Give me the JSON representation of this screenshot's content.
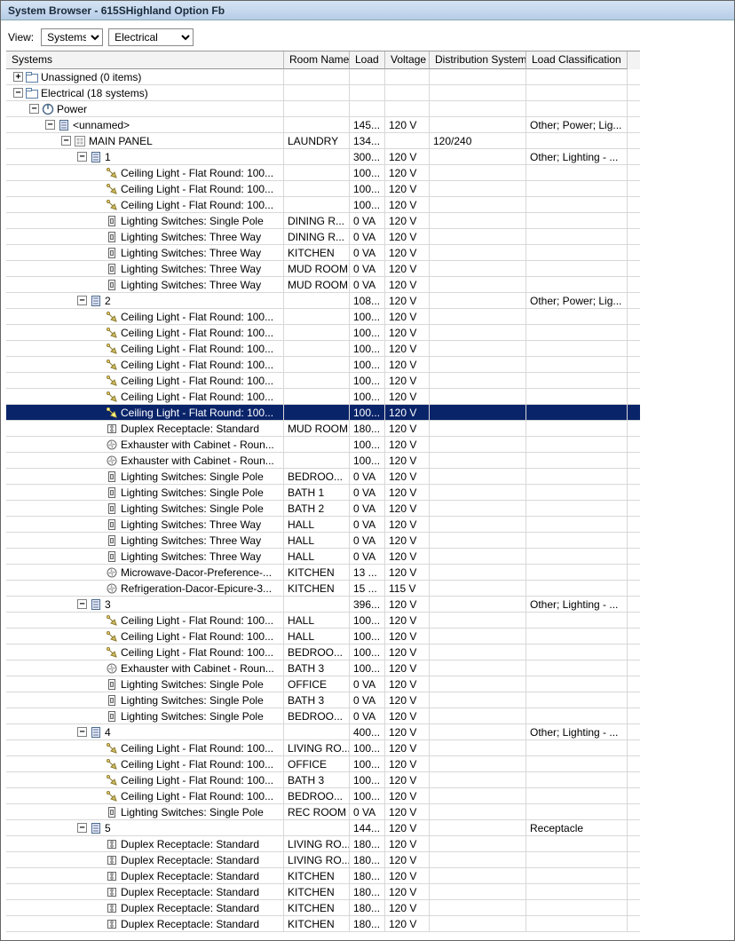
{
  "title": "System Browser - 615SHighland Option Fb",
  "toolbar": {
    "view_label": "View:",
    "view1": "Systems",
    "view2": "Electrical"
  },
  "columns": {
    "systems": "Systems",
    "room": "Room Name",
    "load": "Load",
    "volt": "Voltage",
    "dist": "Distribution System",
    "class": "Load Classification"
  },
  "rows": [
    {
      "indent": 0,
      "tw": "+",
      "icon": "folder",
      "label": "Unassigned (0 items)",
      "room": "",
      "load": "",
      "volt": "",
      "dist": "",
      "class": ""
    },
    {
      "indent": 0,
      "tw": "-",
      "icon": "folder",
      "label": "Electrical (18 systems)",
      "room": "",
      "load": "",
      "volt": "",
      "dist": "",
      "class": ""
    },
    {
      "indent": 1,
      "tw": "-",
      "icon": "power",
      "label": "Power",
      "room": "",
      "load": "",
      "volt": "",
      "dist": "",
      "class": ""
    },
    {
      "indent": 2,
      "tw": "-",
      "icon": "panel",
      "label": "<unnamed>",
      "room": "",
      "load": "145...",
      "volt": "120 V",
      "dist": "",
      "class": "Other; Power; Lig..."
    },
    {
      "indent": 3,
      "tw": "-",
      "icon": "panel2",
      "label": "MAIN PANEL",
      "room": "LAUNDRY",
      "load": "134...",
      "volt": "",
      "dist": "120/240",
      "class": ""
    },
    {
      "indent": 4,
      "tw": "-",
      "icon": "panel",
      "label": "1",
      "room": "",
      "load": "300...",
      "volt": "120 V",
      "dist": "",
      "class": "Other; Lighting - ..."
    },
    {
      "indent": 5,
      "tw": "",
      "icon": "light",
      "label": "Ceiling Light - Flat Round: 100...",
      "room": "",
      "load": "100...",
      "volt": "120 V",
      "dist": "",
      "class": ""
    },
    {
      "indent": 5,
      "tw": "",
      "icon": "light",
      "label": "Ceiling Light - Flat Round: 100...",
      "room": "",
      "load": "100...",
      "volt": "120 V",
      "dist": "",
      "class": ""
    },
    {
      "indent": 5,
      "tw": "",
      "icon": "light",
      "label": "Ceiling Light - Flat Round: 100...",
      "room": "",
      "load": "100...",
      "volt": "120 V",
      "dist": "",
      "class": ""
    },
    {
      "indent": 5,
      "tw": "",
      "icon": "switch",
      "label": "Lighting Switches: Single Pole",
      "room": "DINING R...",
      "load": "0 VA",
      "volt": "120 V",
      "dist": "",
      "class": ""
    },
    {
      "indent": 5,
      "tw": "",
      "icon": "switch",
      "label": "Lighting Switches: Three Way",
      "room": "DINING R...",
      "load": "0 VA",
      "volt": "120 V",
      "dist": "",
      "class": ""
    },
    {
      "indent": 5,
      "tw": "",
      "icon": "switch",
      "label": "Lighting Switches: Three Way",
      "room": "KITCHEN",
      "load": "0 VA",
      "volt": "120 V",
      "dist": "",
      "class": ""
    },
    {
      "indent": 5,
      "tw": "",
      "icon": "switch",
      "label": "Lighting Switches: Three Way",
      "room": "MUD ROOM",
      "load": "0 VA",
      "volt": "120 V",
      "dist": "",
      "class": ""
    },
    {
      "indent": 5,
      "tw": "",
      "icon": "switch",
      "label": "Lighting Switches: Three Way",
      "room": "MUD ROOM",
      "load": "0 VA",
      "volt": "120 V",
      "dist": "",
      "class": ""
    },
    {
      "indent": 4,
      "tw": "-",
      "icon": "panel",
      "label": "2",
      "room": "",
      "load": "108...",
      "volt": "120 V",
      "dist": "",
      "class": "Other; Power; Lig..."
    },
    {
      "indent": 5,
      "tw": "",
      "icon": "light",
      "label": "Ceiling Light - Flat Round: 100...",
      "room": "",
      "load": "100...",
      "volt": "120 V",
      "dist": "",
      "class": ""
    },
    {
      "indent": 5,
      "tw": "",
      "icon": "light",
      "label": "Ceiling Light - Flat Round: 100...",
      "room": "",
      "load": "100...",
      "volt": "120 V",
      "dist": "",
      "class": ""
    },
    {
      "indent": 5,
      "tw": "",
      "icon": "light",
      "label": "Ceiling Light - Flat Round: 100...",
      "room": "",
      "load": "100...",
      "volt": "120 V",
      "dist": "",
      "class": ""
    },
    {
      "indent": 5,
      "tw": "",
      "icon": "light",
      "label": "Ceiling Light - Flat Round: 100...",
      "room": "",
      "load": "100...",
      "volt": "120 V",
      "dist": "",
      "class": ""
    },
    {
      "indent": 5,
      "tw": "",
      "icon": "light",
      "label": "Ceiling Light - Flat Round: 100...",
      "room": "",
      "load": "100...",
      "volt": "120 V",
      "dist": "",
      "class": ""
    },
    {
      "indent": 5,
      "tw": "",
      "icon": "light",
      "label": "Ceiling Light - Flat Round: 100...",
      "room": "",
      "load": "100...",
      "volt": "120 V",
      "dist": "",
      "class": ""
    },
    {
      "indent": 5,
      "tw": "",
      "icon": "light",
      "label": "Ceiling Light - Flat Round: 100...",
      "room": "",
      "load": "100...",
      "volt": "120 V",
      "dist": "",
      "class": "",
      "selected": true
    },
    {
      "indent": 5,
      "tw": "",
      "icon": "outlet",
      "label": "Duplex Receptacle: Standard",
      "room": "MUD ROOM",
      "load": "180...",
      "volt": "120 V",
      "dist": "",
      "class": ""
    },
    {
      "indent": 5,
      "tw": "",
      "icon": "fan",
      "label": "Exhauster with Cabinet - Roun...",
      "room": "",
      "load": "100...",
      "volt": "120 V",
      "dist": "",
      "class": ""
    },
    {
      "indent": 5,
      "tw": "",
      "icon": "fan",
      "label": "Exhauster with Cabinet - Roun...",
      "room": "",
      "load": "100...",
      "volt": "120 V",
      "dist": "",
      "class": ""
    },
    {
      "indent": 5,
      "tw": "",
      "icon": "switch",
      "label": "Lighting Switches: Single Pole",
      "room": "BEDROO...",
      "load": "0 VA",
      "volt": "120 V",
      "dist": "",
      "class": ""
    },
    {
      "indent": 5,
      "tw": "",
      "icon": "switch",
      "label": "Lighting Switches: Single Pole",
      "room": "BATH 1",
      "load": "0 VA",
      "volt": "120 V",
      "dist": "",
      "class": ""
    },
    {
      "indent": 5,
      "tw": "",
      "icon": "switch",
      "label": "Lighting Switches: Single Pole",
      "room": "BATH 2",
      "load": "0 VA",
      "volt": "120 V",
      "dist": "",
      "class": ""
    },
    {
      "indent": 5,
      "tw": "",
      "icon": "switch",
      "label": "Lighting Switches: Three Way",
      "room": "HALL",
      "load": "0 VA",
      "volt": "120 V",
      "dist": "",
      "class": ""
    },
    {
      "indent": 5,
      "tw": "",
      "icon": "switch",
      "label": "Lighting Switches: Three Way",
      "room": "HALL",
      "load": "0 VA",
      "volt": "120 V",
      "dist": "",
      "class": ""
    },
    {
      "indent": 5,
      "tw": "",
      "icon": "switch",
      "label": "Lighting Switches: Three Way",
      "room": "HALL",
      "load": "0 VA",
      "volt": "120 V",
      "dist": "",
      "class": ""
    },
    {
      "indent": 5,
      "tw": "",
      "icon": "fan",
      "label": "Microwave-Dacor-Preference-...",
      "room": "KITCHEN",
      "load": "13 ...",
      "volt": "120 V",
      "dist": "",
      "class": ""
    },
    {
      "indent": 5,
      "tw": "",
      "icon": "fan",
      "label": "Refrigeration-Dacor-Epicure-3...",
      "room": "KITCHEN",
      "load": "15 ...",
      "volt": "115 V",
      "dist": "",
      "class": ""
    },
    {
      "indent": 4,
      "tw": "-",
      "icon": "panel",
      "label": "3",
      "room": "",
      "load": "396...",
      "volt": "120 V",
      "dist": "",
      "class": "Other; Lighting - ..."
    },
    {
      "indent": 5,
      "tw": "",
      "icon": "light",
      "label": "Ceiling Light - Flat Round: 100...",
      "room": "HALL",
      "load": "100...",
      "volt": "120 V",
      "dist": "",
      "class": ""
    },
    {
      "indent": 5,
      "tw": "",
      "icon": "light",
      "label": "Ceiling Light - Flat Round: 100...",
      "room": "HALL",
      "load": "100...",
      "volt": "120 V",
      "dist": "",
      "class": ""
    },
    {
      "indent": 5,
      "tw": "",
      "icon": "light",
      "label": "Ceiling Light - Flat Round: 100...",
      "room": "BEDROO...",
      "load": "100...",
      "volt": "120 V",
      "dist": "",
      "class": ""
    },
    {
      "indent": 5,
      "tw": "",
      "icon": "fan",
      "label": "Exhauster with Cabinet - Roun...",
      "room": "BATH 3",
      "load": "100...",
      "volt": "120 V",
      "dist": "",
      "class": ""
    },
    {
      "indent": 5,
      "tw": "",
      "icon": "switch",
      "label": "Lighting Switches: Single Pole",
      "room": "OFFICE",
      "load": "0 VA",
      "volt": "120 V",
      "dist": "",
      "class": ""
    },
    {
      "indent": 5,
      "tw": "",
      "icon": "switch",
      "label": "Lighting Switches: Single Pole",
      "room": "BATH 3",
      "load": "0 VA",
      "volt": "120 V",
      "dist": "",
      "class": ""
    },
    {
      "indent": 5,
      "tw": "",
      "icon": "switch",
      "label": "Lighting Switches: Single Pole",
      "room": "BEDROO...",
      "load": "0 VA",
      "volt": "120 V",
      "dist": "",
      "class": ""
    },
    {
      "indent": 4,
      "tw": "-",
      "icon": "panel",
      "label": "4",
      "room": "",
      "load": "400...",
      "volt": "120 V",
      "dist": "",
      "class": "Other; Lighting - ..."
    },
    {
      "indent": 5,
      "tw": "",
      "icon": "light",
      "label": "Ceiling Light - Flat Round: 100...",
      "room": "LIVING RO...",
      "load": "100...",
      "volt": "120 V",
      "dist": "",
      "class": ""
    },
    {
      "indent": 5,
      "tw": "",
      "icon": "light",
      "label": "Ceiling Light - Flat Round: 100...",
      "room": "OFFICE",
      "load": "100...",
      "volt": "120 V",
      "dist": "",
      "class": ""
    },
    {
      "indent": 5,
      "tw": "",
      "icon": "light",
      "label": "Ceiling Light - Flat Round: 100...",
      "room": "BATH 3",
      "load": "100...",
      "volt": "120 V",
      "dist": "",
      "class": ""
    },
    {
      "indent": 5,
      "tw": "",
      "icon": "light",
      "label": "Ceiling Light - Flat Round: 100...",
      "room": "BEDROO...",
      "load": "100...",
      "volt": "120 V",
      "dist": "",
      "class": ""
    },
    {
      "indent": 5,
      "tw": "",
      "icon": "switch",
      "label": "Lighting Switches: Single Pole",
      "room": "REC ROOM",
      "load": "0 VA",
      "volt": "120 V",
      "dist": "",
      "class": ""
    },
    {
      "indent": 4,
      "tw": "-",
      "icon": "panel",
      "label": "5",
      "room": "",
      "load": "144...",
      "volt": "120 V",
      "dist": "",
      "class": "Receptacle"
    },
    {
      "indent": 5,
      "tw": "",
      "icon": "outlet",
      "label": "Duplex Receptacle: Standard",
      "room": "LIVING RO...",
      "load": "180...",
      "volt": "120 V",
      "dist": "",
      "class": ""
    },
    {
      "indent": 5,
      "tw": "",
      "icon": "outlet",
      "label": "Duplex Receptacle: Standard",
      "room": "LIVING RO...",
      "load": "180...",
      "volt": "120 V",
      "dist": "",
      "class": ""
    },
    {
      "indent": 5,
      "tw": "",
      "icon": "outlet",
      "label": "Duplex Receptacle: Standard",
      "room": "KITCHEN",
      "load": "180...",
      "volt": "120 V",
      "dist": "",
      "class": ""
    },
    {
      "indent": 5,
      "tw": "",
      "icon": "outlet",
      "label": "Duplex Receptacle: Standard",
      "room": "KITCHEN",
      "load": "180...",
      "volt": "120 V",
      "dist": "",
      "class": ""
    },
    {
      "indent": 5,
      "tw": "",
      "icon": "outlet",
      "label": "Duplex Receptacle: Standard",
      "room": "KITCHEN",
      "load": "180...",
      "volt": "120 V",
      "dist": "",
      "class": ""
    },
    {
      "indent": 5,
      "tw": "",
      "icon": "outlet",
      "label": "Duplex Receptacle: Standard",
      "room": "KITCHEN",
      "load": "180...",
      "volt": "120 V",
      "dist": "",
      "class": ""
    }
  ]
}
